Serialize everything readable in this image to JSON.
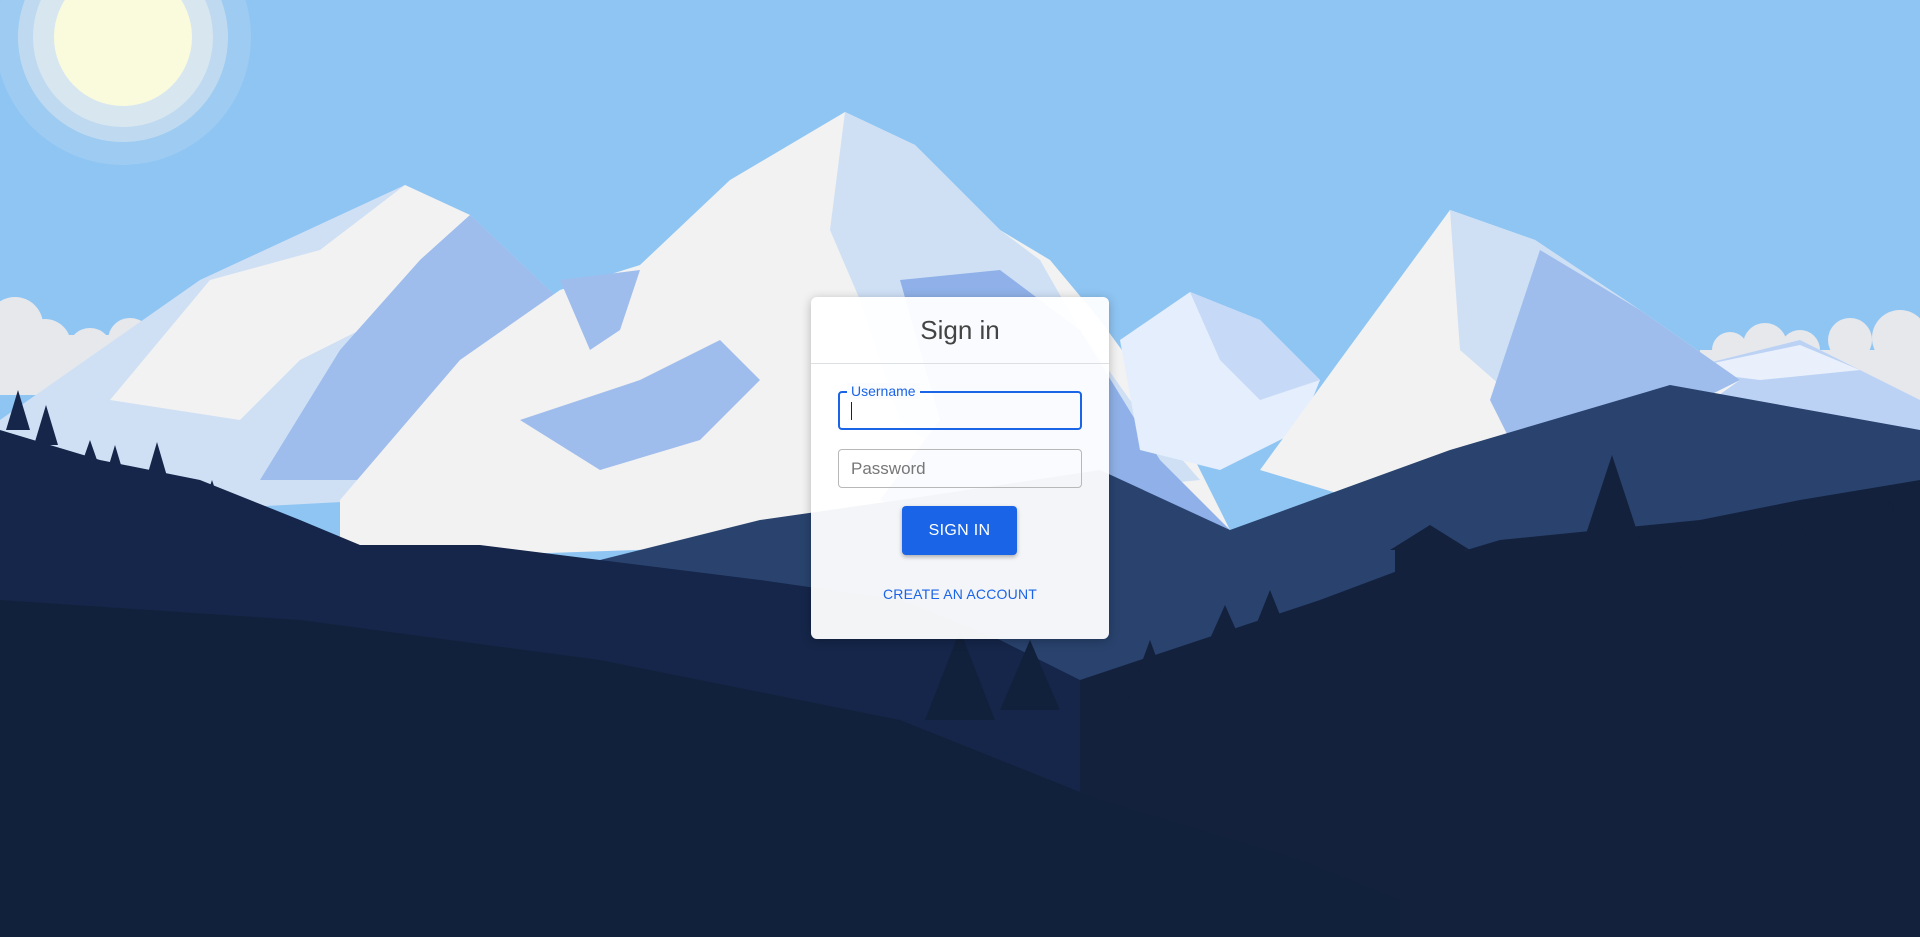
{
  "login": {
    "title": "Sign in",
    "username": {
      "label": "Username",
      "value": ""
    },
    "password": {
      "placeholder": "Password",
      "value": ""
    },
    "signin_label": "SIGN IN",
    "create_account_label": "CREATE AN ACCOUNT"
  },
  "colors": {
    "accent": "#1a64e8",
    "sky": "#8fc5f3",
    "sun": "#fafbdd",
    "forest": "#12213b"
  }
}
